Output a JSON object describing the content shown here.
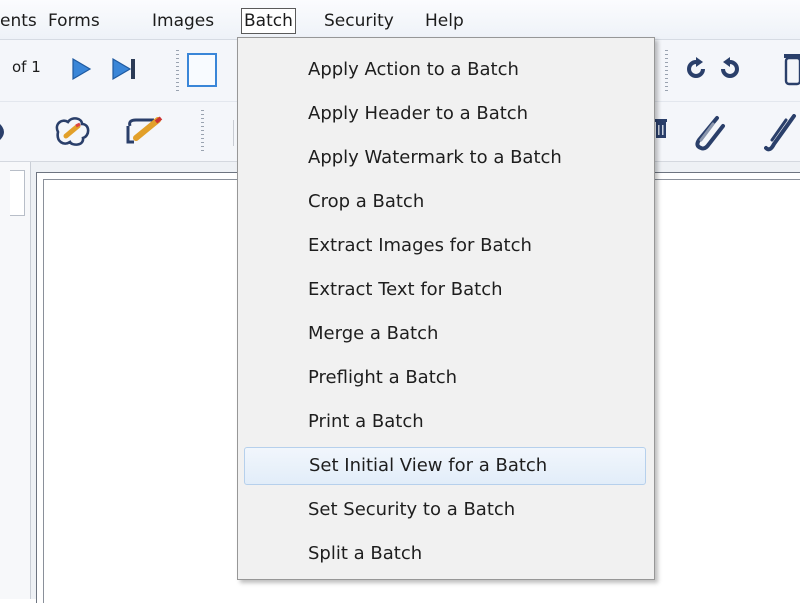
{
  "menubar": {
    "items": [
      {
        "label": "ents"
      },
      {
        "label": "Forms"
      },
      {
        "label": "Images"
      },
      {
        "label": "Batch",
        "active": true
      },
      {
        "label": "Security"
      },
      {
        "label": "Help"
      }
    ]
  },
  "toolbar": {
    "page_of": "of 1",
    "icons": [
      "next-page-icon",
      "last-page-icon",
      "single-page-view-icon",
      "rotate-counterclockwise-icon",
      "rotate-clockwise-icon",
      "trash-icon",
      "stamp-icon",
      "pencil-edit-icon",
      "delete-icon",
      "attach-file-icon",
      "paperclip-icon"
    ]
  },
  "batch_menu": {
    "highlighted_index": 9,
    "items": [
      "Apply Action to a Batch",
      "Apply Header to a Batch",
      "Apply Watermark to a Batch",
      "Crop a Batch",
      "Extract Images for Batch",
      "Extract Text for Batch",
      "Merge a Batch",
      "Preflight a Batch",
      "Print a Batch",
      "Set Initial View for a Batch",
      "Set Security to a Batch",
      "Split a Batch"
    ]
  },
  "colors": {
    "menu_background": "#f1f1f1",
    "highlight": "#e2edf9",
    "highlight_border": "#b6d0ec",
    "nav_arrow": "#3a86d8"
  }
}
